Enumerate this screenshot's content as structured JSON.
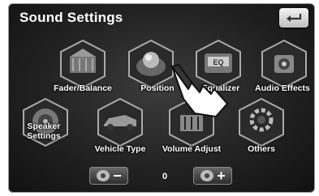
{
  "header": {
    "title": "Sound Settings"
  },
  "menu": [
    {
      "id": "fader-balance",
      "label": "Fader/Balance",
      "icon": "fader-balance-icon"
    },
    {
      "id": "position",
      "label": "Position",
      "icon": "position-icon"
    },
    {
      "id": "equalizer",
      "label": "Equalizer",
      "icon": "equalizer-icon"
    },
    {
      "id": "audio-effects",
      "label": "Audio Effects",
      "icon": "audio-effects-icon"
    },
    {
      "id": "speaker-settings",
      "label_line1": "Speaker",
      "label_line2": "Settings",
      "icon": "speaker-settings-icon"
    },
    {
      "id": "vehicle-type",
      "label": "Vehicle Type",
      "icon": "vehicle-type-icon"
    },
    {
      "id": "volume-adjust",
      "label": "Volume Adjust",
      "icon": "volume-adjust-icon"
    },
    {
      "id": "others",
      "label": "Others",
      "icon": "gear-icon"
    }
  ],
  "volume": {
    "value": "0",
    "minus_label": "−",
    "plus_label": "+"
  },
  "colors": {
    "background": "#222222",
    "text": "#ffffff",
    "button": "#dddddd"
  }
}
